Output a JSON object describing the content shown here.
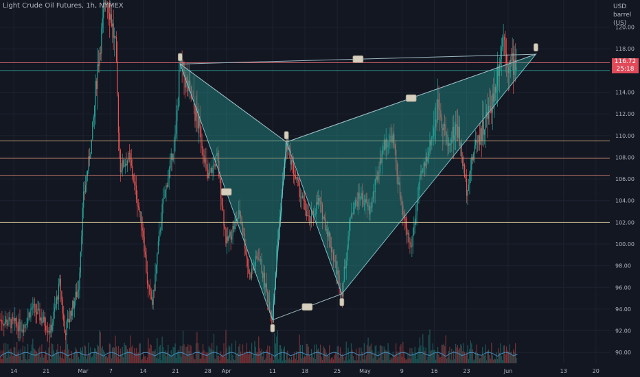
{
  "chart_title": "Light Crude Oil Futures, 1h, NYMEX",
  "currency": "USD",
  "unit": "barrel (US)",
  "last_price": "116.72",
  "countdown": "25:18",
  "chart_data": {
    "type": "candlestick",
    "ylim": [
      89,
      122.5
    ],
    "xlim": [
      "2022-02-11",
      "2022-06-23"
    ],
    "yticks": [
      90,
      92,
      94,
      96,
      98,
      100,
      102,
      104,
      106,
      108,
      110,
      112,
      114,
      116,
      118,
      120
    ],
    "xticks": [
      {
        "label": "14",
        "date": "2022-02-14"
      },
      {
        "label": "21",
        "date": "2022-02-21"
      },
      {
        "label": "Mar",
        "date": "2022-03-01"
      },
      {
        "label": "7",
        "date": "2022-03-07"
      },
      {
        "label": "14",
        "date": "2022-03-14"
      },
      {
        "label": "21",
        "date": "2022-03-21"
      },
      {
        "label": "28",
        "date": "2022-03-28"
      },
      {
        "label": "Apr",
        "date": "2022-04-01"
      },
      {
        "label": "11",
        "date": "2022-04-11"
      },
      {
        "label": "18",
        "date": "2022-04-18"
      },
      {
        "label": "25",
        "date": "2022-04-25"
      },
      {
        "label": "May",
        "date": "2022-05-01"
      },
      {
        "label": "9",
        "date": "2022-05-09"
      },
      {
        "label": "16",
        "date": "2022-05-16"
      },
      {
        "label": "23",
        "date": "2022-05-23"
      },
      {
        "label": "Jun",
        "date": "2022-06-01"
      },
      {
        "label": "13",
        "date": "2022-06-13"
      },
      {
        "label": "20",
        "date": "2022-06-20"
      }
    ],
    "horizontal_levels": [
      {
        "y": 116.72,
        "color": "#e06c75"
      },
      {
        "y": 116.0,
        "color": "#26a69a"
      },
      {
        "y": 109.5,
        "color": "#c9a57a"
      },
      {
        "y": 107.9,
        "color": "#d98a6a"
      },
      {
        "y": 106.3,
        "color": "#e08a7a"
      },
      {
        "y": 102.0,
        "color": "#e8d9a0"
      }
    ],
    "pattern_points": [
      {
        "x": "2022-03-22",
        "y": 116.6
      },
      {
        "x": "2022-04-11",
        "y": 93.0
      },
      {
        "x": "2022-04-14",
        "y": 109.4
      },
      {
        "x": "2022-04-26",
        "y": 95.4
      },
      {
        "x": "2022-06-07",
        "y": 117.5
      }
    ],
    "close_path": [
      {
        "x": "2022-02-11",
        "y": 93.0
      },
      {
        "x": "2022-02-16",
        "y": 92.4
      },
      {
        "x": "2022-02-18",
        "y": 94.2
      },
      {
        "x": "2022-02-22",
        "y": 92.0
      },
      {
        "x": "2022-02-24",
        "y": 96.5
      },
      {
        "x": "2022-02-25",
        "y": 91.8
      },
      {
        "x": "2022-02-28",
        "y": 96.0
      },
      {
        "x": "2022-03-01",
        "y": 104.0
      },
      {
        "x": "2022-03-03",
        "y": 110.0
      },
      {
        "x": "2022-03-04",
        "y": 116.0
      },
      {
        "x": "2022-03-06",
        "y": 123.0
      },
      {
        "x": "2022-03-07",
        "y": 121.0
      },
      {
        "x": "2022-03-08",
        "y": 118.0
      },
      {
        "x": "2022-03-09",
        "y": 107.0
      },
      {
        "x": "2022-03-11",
        "y": 108.0
      },
      {
        "x": "2022-03-14",
        "y": 101.0
      },
      {
        "x": "2022-03-15",
        "y": 96.0
      },
      {
        "x": "2022-03-16",
        "y": 94.5
      },
      {
        "x": "2022-03-18",
        "y": 103.0
      },
      {
        "x": "2022-03-21",
        "y": 110.0
      },
      {
        "x": "2022-03-22",
        "y": 116.6
      },
      {
        "x": "2022-03-24",
        "y": 114.0
      },
      {
        "x": "2022-03-26",
        "y": 111.0
      },
      {
        "x": "2022-03-28",
        "y": 106.0
      },
      {
        "x": "2022-03-30",
        "y": 108.0
      },
      {
        "x": "2022-04-01",
        "y": 100.0
      },
      {
        "x": "2022-04-04",
        "y": 103.0
      },
      {
        "x": "2022-04-06",
        "y": 97.0
      },
      {
        "x": "2022-04-08",
        "y": 99.0
      },
      {
        "x": "2022-04-11",
        "y": 93.0
      },
      {
        "x": "2022-04-12",
        "y": 100.0
      },
      {
        "x": "2022-04-14",
        "y": 109.4
      },
      {
        "x": "2022-04-16",
        "y": 106.0
      },
      {
        "x": "2022-04-19",
        "y": 102.0
      },
      {
        "x": "2022-04-21",
        "y": 104.0
      },
      {
        "x": "2022-04-23",
        "y": 101.0
      },
      {
        "x": "2022-04-26",
        "y": 95.4
      },
      {
        "x": "2022-04-28",
        "y": 103.0
      },
      {
        "x": "2022-04-30",
        "y": 104.5
      },
      {
        "x": "2022-05-02",
        "y": 103.0
      },
      {
        "x": "2022-05-05",
        "y": 109.0
      },
      {
        "x": "2022-05-07",
        "y": 110.0
      },
      {
        "x": "2022-05-09",
        "y": 103.0
      },
      {
        "x": "2022-05-11",
        "y": 99.5
      },
      {
        "x": "2022-05-13",
        "y": 106.0
      },
      {
        "x": "2022-05-15",
        "y": 109.0
      },
      {
        "x": "2022-05-17",
        "y": 113.0
      },
      {
        "x": "2022-05-19",
        "y": 109.0
      },
      {
        "x": "2022-05-21",
        "y": 111.0
      },
      {
        "x": "2022-05-23",
        "y": 105.0
      },
      {
        "x": "2022-05-25",
        "y": 109.5
      },
      {
        "x": "2022-05-27",
        "y": 111.0
      },
      {
        "x": "2022-05-29",
        "y": 114.0
      },
      {
        "x": "2022-05-31",
        "y": 119.5
      },
      {
        "x": "2022-06-01",
        "y": 116.5
      },
      {
        "x": "2022-06-03",
        "y": 116.72
      }
    ]
  }
}
